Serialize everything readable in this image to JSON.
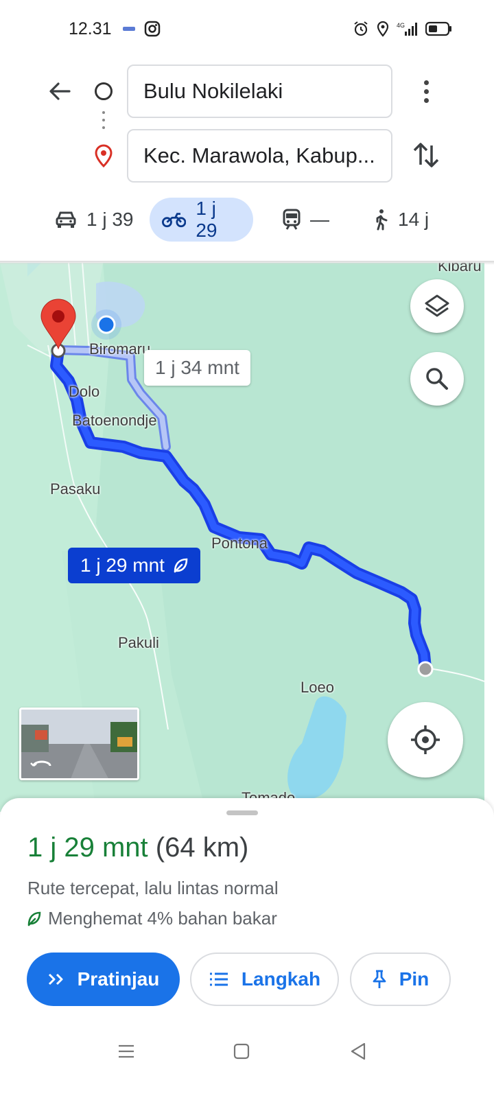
{
  "status_bar": {
    "time": "12.31",
    "network": "4G"
  },
  "route": {
    "origin": "Bulu Nokilelaki",
    "destination": "Kec. Marawola, Kabup..."
  },
  "modes": [
    {
      "name": "car",
      "label": "1 j 39",
      "icon": "car-icon",
      "selected": false
    },
    {
      "name": "motorcycle",
      "label": "1 j 29",
      "icon": "motorcycle-icon",
      "selected": true
    },
    {
      "name": "transit",
      "label": "—",
      "icon": "train-icon",
      "selected": false
    },
    {
      "name": "walk",
      "label": "14 j",
      "icon": "walk-icon",
      "selected": false
    }
  ],
  "map": {
    "places": {
      "kibaru": "Kibaru",
      "biromaru": "Biromaru",
      "dolo": "Dolo",
      "batoenondje": "Batoenondje",
      "pasaku": "Pasaku",
      "pontona": "Pontona",
      "pakuli": "Pakuli",
      "loeo": "Loeo",
      "tomado": "Tomado"
    },
    "alt_route_label": "1 j 34 mnt",
    "main_route_label": "1 j 29 mnt",
    "route_color": "#1a3fe6",
    "alt_route_color": "#9fb4f0"
  },
  "sheet": {
    "duration": "1 j 29 mnt",
    "distance": "(64 km)",
    "description": "Rute tercepat, lalu lintas normal",
    "fuel_text": "Menghemat 4% bahan bakar",
    "buttons": {
      "preview": "Pratinjau",
      "steps": "Langkah",
      "pin": "Pin"
    }
  },
  "colors": {
    "accent": "#1a73e8",
    "duration_green": "#188038",
    "selected_mode_bg": "#d3e3fd"
  }
}
